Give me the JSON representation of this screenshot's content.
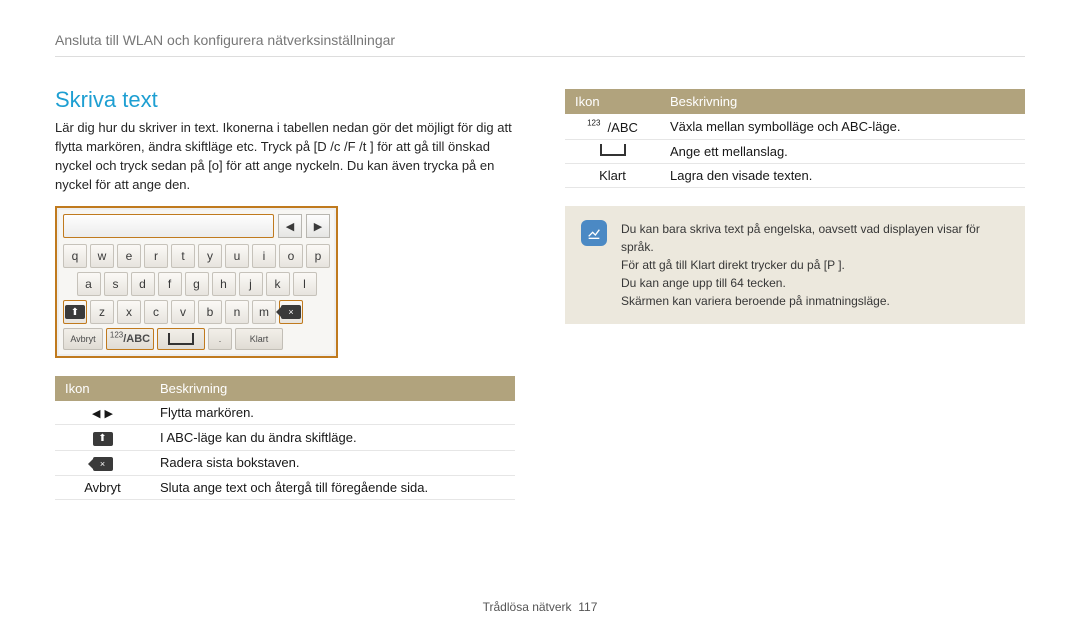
{
  "breadcrumb": "Ansluta till WLAN och konﬁgurera nätverksinställningar",
  "section_title": "Skriva text",
  "intro": "Lär dig hur du skriver in text. Ikonerna i tabellen nedan gör det möjligt för dig att ﬂytta markören, ändra skiftläge etc. Tryck på [D /c /F /t ] för att gå till önskad nyckel och tryck sedan på [o] för att ange nyckeln. Du kan även trycka på en nyckel för att ange den.",
  "keyboard": {
    "row1": [
      "q",
      "w",
      "e",
      "r",
      "t",
      "y",
      "u",
      "i",
      "o",
      "p"
    ],
    "row2": [
      "a",
      "s",
      "d",
      "f",
      "g",
      "h",
      "j",
      "k",
      "l"
    ],
    "row3": [
      "z",
      "x",
      "c",
      "v",
      "b",
      "n",
      "m"
    ],
    "fn_avbryt": "Avbryt",
    "fn_abc": "123/ABC",
    "fn_klart": "Klart"
  },
  "table_left": {
    "head_icon": "Ikon",
    "head_desc": "Beskrivning",
    "r1": "Flytta markören.",
    "r2": "I ABC-läge kan du ändra skiftläge.",
    "r3": "Radera sista bokstaven.",
    "r4_icon": "Avbryt",
    "r4": "Sluta ange text och återgå till föregående sida."
  },
  "table_right": {
    "head_icon": "Ikon",
    "head_desc": "Beskrivning",
    "r1_icon": "/ABC",
    "r1": "Växla mellan symbolläge och ABC-läge.",
    "r2": "Ange ett mellanslag.",
    "r3_icon": "Klart",
    "r3": "Lagra den visade texten."
  },
  "note": {
    "l1": "Du kan bara skriva text på engelska, oavsett vad displayen visar för språk.",
    "l2": "För att gå till Klart direkt trycker du på [P   ].",
    "l3": "Du kan ange upp till 64 tecken.",
    "l4": "Skärmen kan variera beroende på inmatningsläge."
  },
  "footer_label": "Trådlösa nätverk",
  "footer_page": "117"
}
